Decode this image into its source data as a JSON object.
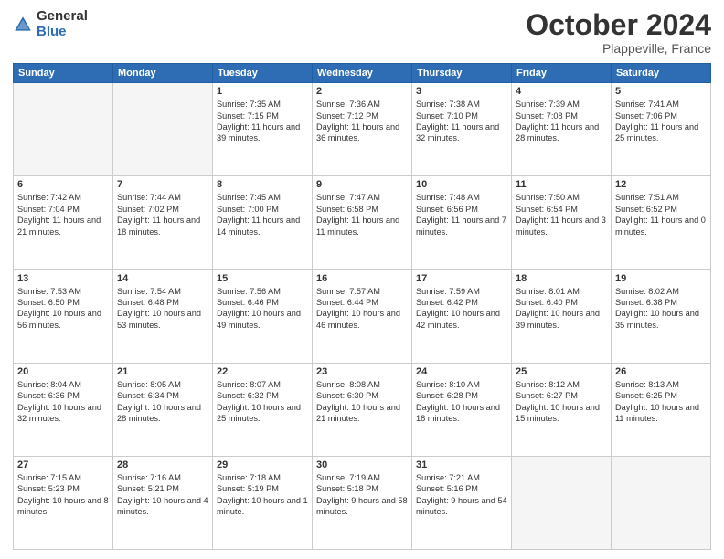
{
  "header": {
    "logo_general": "General",
    "logo_blue": "Blue",
    "month_title": "October 2024",
    "location": "Plappeville, France"
  },
  "weekdays": [
    "Sunday",
    "Monday",
    "Tuesday",
    "Wednesday",
    "Thursday",
    "Friday",
    "Saturday"
  ],
  "weeks": [
    [
      {
        "day": "",
        "info": ""
      },
      {
        "day": "",
        "info": ""
      },
      {
        "day": "1",
        "info": "Sunrise: 7:35 AM\nSunset: 7:15 PM\nDaylight: 11 hours and 39 minutes."
      },
      {
        "day": "2",
        "info": "Sunrise: 7:36 AM\nSunset: 7:12 PM\nDaylight: 11 hours and 36 minutes."
      },
      {
        "day": "3",
        "info": "Sunrise: 7:38 AM\nSunset: 7:10 PM\nDaylight: 11 hours and 32 minutes."
      },
      {
        "day": "4",
        "info": "Sunrise: 7:39 AM\nSunset: 7:08 PM\nDaylight: 11 hours and 28 minutes."
      },
      {
        "day": "5",
        "info": "Sunrise: 7:41 AM\nSunset: 7:06 PM\nDaylight: 11 hours and 25 minutes."
      }
    ],
    [
      {
        "day": "6",
        "info": "Sunrise: 7:42 AM\nSunset: 7:04 PM\nDaylight: 11 hours and 21 minutes."
      },
      {
        "day": "7",
        "info": "Sunrise: 7:44 AM\nSunset: 7:02 PM\nDaylight: 11 hours and 18 minutes."
      },
      {
        "day": "8",
        "info": "Sunrise: 7:45 AM\nSunset: 7:00 PM\nDaylight: 11 hours and 14 minutes."
      },
      {
        "day": "9",
        "info": "Sunrise: 7:47 AM\nSunset: 6:58 PM\nDaylight: 11 hours and 11 minutes."
      },
      {
        "day": "10",
        "info": "Sunrise: 7:48 AM\nSunset: 6:56 PM\nDaylight: 11 hours and 7 minutes."
      },
      {
        "day": "11",
        "info": "Sunrise: 7:50 AM\nSunset: 6:54 PM\nDaylight: 11 hours and 3 minutes."
      },
      {
        "day": "12",
        "info": "Sunrise: 7:51 AM\nSunset: 6:52 PM\nDaylight: 11 hours and 0 minutes."
      }
    ],
    [
      {
        "day": "13",
        "info": "Sunrise: 7:53 AM\nSunset: 6:50 PM\nDaylight: 10 hours and 56 minutes."
      },
      {
        "day": "14",
        "info": "Sunrise: 7:54 AM\nSunset: 6:48 PM\nDaylight: 10 hours and 53 minutes."
      },
      {
        "day": "15",
        "info": "Sunrise: 7:56 AM\nSunset: 6:46 PM\nDaylight: 10 hours and 49 minutes."
      },
      {
        "day": "16",
        "info": "Sunrise: 7:57 AM\nSunset: 6:44 PM\nDaylight: 10 hours and 46 minutes."
      },
      {
        "day": "17",
        "info": "Sunrise: 7:59 AM\nSunset: 6:42 PM\nDaylight: 10 hours and 42 minutes."
      },
      {
        "day": "18",
        "info": "Sunrise: 8:01 AM\nSunset: 6:40 PM\nDaylight: 10 hours and 39 minutes."
      },
      {
        "day": "19",
        "info": "Sunrise: 8:02 AM\nSunset: 6:38 PM\nDaylight: 10 hours and 35 minutes."
      }
    ],
    [
      {
        "day": "20",
        "info": "Sunrise: 8:04 AM\nSunset: 6:36 PM\nDaylight: 10 hours and 32 minutes."
      },
      {
        "day": "21",
        "info": "Sunrise: 8:05 AM\nSunset: 6:34 PM\nDaylight: 10 hours and 28 minutes."
      },
      {
        "day": "22",
        "info": "Sunrise: 8:07 AM\nSunset: 6:32 PM\nDaylight: 10 hours and 25 minutes."
      },
      {
        "day": "23",
        "info": "Sunrise: 8:08 AM\nSunset: 6:30 PM\nDaylight: 10 hours and 21 minutes."
      },
      {
        "day": "24",
        "info": "Sunrise: 8:10 AM\nSunset: 6:28 PM\nDaylight: 10 hours and 18 minutes."
      },
      {
        "day": "25",
        "info": "Sunrise: 8:12 AM\nSunset: 6:27 PM\nDaylight: 10 hours and 15 minutes."
      },
      {
        "day": "26",
        "info": "Sunrise: 8:13 AM\nSunset: 6:25 PM\nDaylight: 10 hours and 11 minutes."
      }
    ],
    [
      {
        "day": "27",
        "info": "Sunrise: 7:15 AM\nSunset: 5:23 PM\nDaylight: 10 hours and 8 minutes."
      },
      {
        "day": "28",
        "info": "Sunrise: 7:16 AM\nSunset: 5:21 PM\nDaylight: 10 hours and 4 minutes."
      },
      {
        "day": "29",
        "info": "Sunrise: 7:18 AM\nSunset: 5:19 PM\nDaylight: 10 hours and 1 minute."
      },
      {
        "day": "30",
        "info": "Sunrise: 7:19 AM\nSunset: 5:18 PM\nDaylight: 9 hours and 58 minutes."
      },
      {
        "day": "31",
        "info": "Sunrise: 7:21 AM\nSunset: 5:16 PM\nDaylight: 9 hours and 54 minutes."
      },
      {
        "day": "",
        "info": ""
      },
      {
        "day": "",
        "info": ""
      }
    ]
  ]
}
